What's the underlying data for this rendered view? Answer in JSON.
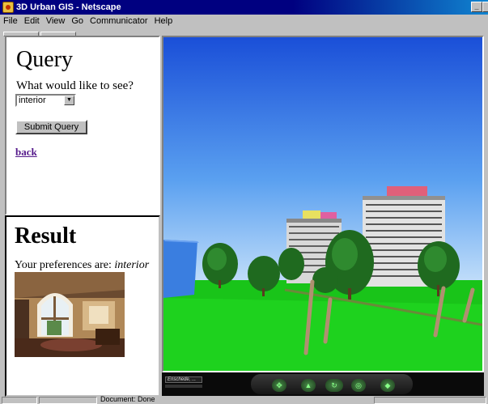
{
  "window": {
    "title": "3D Urban GIS - Netscape"
  },
  "menu": [
    "File",
    "Edit",
    "View",
    "Go",
    "Communicator",
    "Help"
  ],
  "query": {
    "heading": "Query",
    "prompt": "What would like to see?",
    "select_value": "interior",
    "submit_label": "Submit Query",
    "back_label": "back"
  },
  "result": {
    "heading": "Result",
    "prefs_label": "Your preferences are:",
    "prefs_value": "interior"
  },
  "viewer": {
    "viewpoint_label": "Enschede, ..."
  },
  "status": {
    "text": "Document: Done"
  },
  "colors": {
    "titlebar": "#000080",
    "link": "#551a8b",
    "chrome": "#c0c0c0"
  }
}
